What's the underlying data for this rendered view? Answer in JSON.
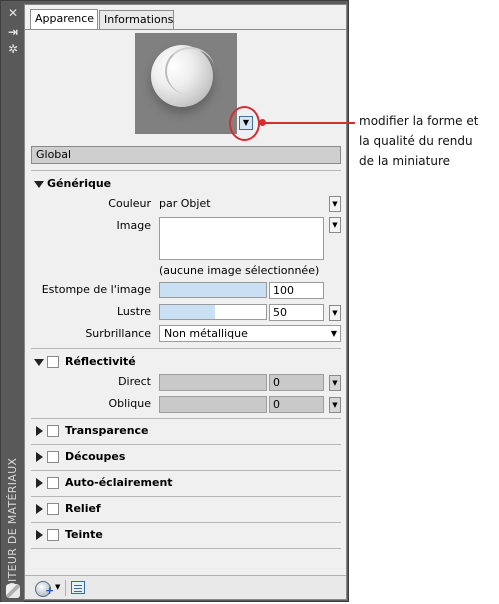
{
  "window": {
    "vertical_title": "EDITEUR DE MATÉRIAUX",
    "titlebar_icons": [
      "close-icon",
      "auto-hide-icon",
      "properties-icon"
    ]
  },
  "tabs": [
    {
      "label": "Apparence",
      "active": true
    },
    {
      "label": "Informations",
      "active": false
    }
  ],
  "preview": {
    "dropdown_glyph": "▼"
  },
  "section_bar": {
    "label": "Global"
  },
  "generic": {
    "title": "Générique",
    "color_label": "Couleur",
    "color_value": "par Objet",
    "image_label": "Image",
    "image_note": "(aucune image sélectionnée)",
    "fade_label": "Estompe de l'image",
    "fade_value": "100",
    "fade_fill": 1.0,
    "gloss_label": "Lustre",
    "gloss_value": "50",
    "gloss_fill": 0.5,
    "highlight_label": "Surbrillance",
    "highlight_value": "Non métallique"
  },
  "reflectivity": {
    "title": "Réflectivité",
    "direct_label": "Direct",
    "direct_value": "0",
    "oblique_label": "Oblique",
    "oblique_value": "0"
  },
  "collapsed_sections": [
    "Transparence",
    "Découpes",
    "Auto-éclairement",
    "Relief",
    "Teinte"
  ],
  "callout": {
    "line1": "modifier la forme et",
    "line2": "la qualité du rendu",
    "line3": "de la miniature",
    "color": "#d23030"
  },
  "colors": {
    "frame": "#5c5c5c",
    "panel": "#f0f0f0",
    "slider_fill": "#c8dff4"
  }
}
